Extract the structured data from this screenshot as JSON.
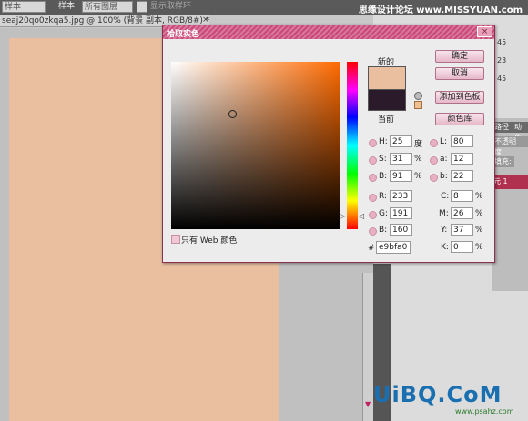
{
  "options_bar": {
    "dropdown1": "样本",
    "label_sample": "样本:",
    "dropdown2": "所有图层",
    "checkbox_label": "显示取样环"
  },
  "watermark": "思缘设计论坛 www.MISSYUAN.com",
  "document_tab": {
    "title": "seaj20qo0zkqa5.jpg @ 100% (背景 副本, RGB/8#) *",
    "close": "×"
  },
  "dialog": {
    "title": "拾取实色",
    "close": "×",
    "new_label": "新的",
    "current_label": "当前",
    "buttons": [
      "确定",
      "取消",
      "添加到色板",
      "颜色库"
    ],
    "websafe_label": "只有 Web 颜色",
    "hex_label": "#",
    "hex_value": "e9bfa0",
    "new_color": "#e9bfa0",
    "current_color": "#2b1a2a",
    "hsb": [
      {
        "label": "H:",
        "value": "25",
        "unit": "度"
      },
      {
        "label": "S:",
        "value": "31",
        "unit": "%"
      },
      {
        "label": "B:",
        "value": "91",
        "unit": "%"
      }
    ],
    "rgb": [
      {
        "label": "R:",
        "value": "233"
      },
      {
        "label": "G:",
        "value": "191"
      },
      {
        "label": "B:",
        "value": "160"
      }
    ],
    "lab": [
      {
        "label": "L:",
        "value": "80"
      },
      {
        "label": "a:",
        "value": "12"
      },
      {
        "label": "b:",
        "value": "22"
      }
    ],
    "cmyk": [
      {
        "label": "C:",
        "value": "8",
        "unit": "%"
      },
      {
        "label": "M:",
        "value": "26",
        "unit": "%"
      },
      {
        "label": "Y:",
        "value": "37",
        "unit": "%"
      },
      {
        "label": "K:",
        "value": "0",
        "unit": "%"
      }
    ]
  },
  "right_panel": {
    "rgb_values": [
      "45",
      "23",
      "45"
    ],
    "tab1": "路径",
    "tab2": "动作",
    "opacity_label": "不透明度:",
    "fill_label": "填充:",
    "layer_name": "元 1"
  },
  "site_logo": "UiBQ.CoM",
  "site_url": "www.psahz.com"
}
